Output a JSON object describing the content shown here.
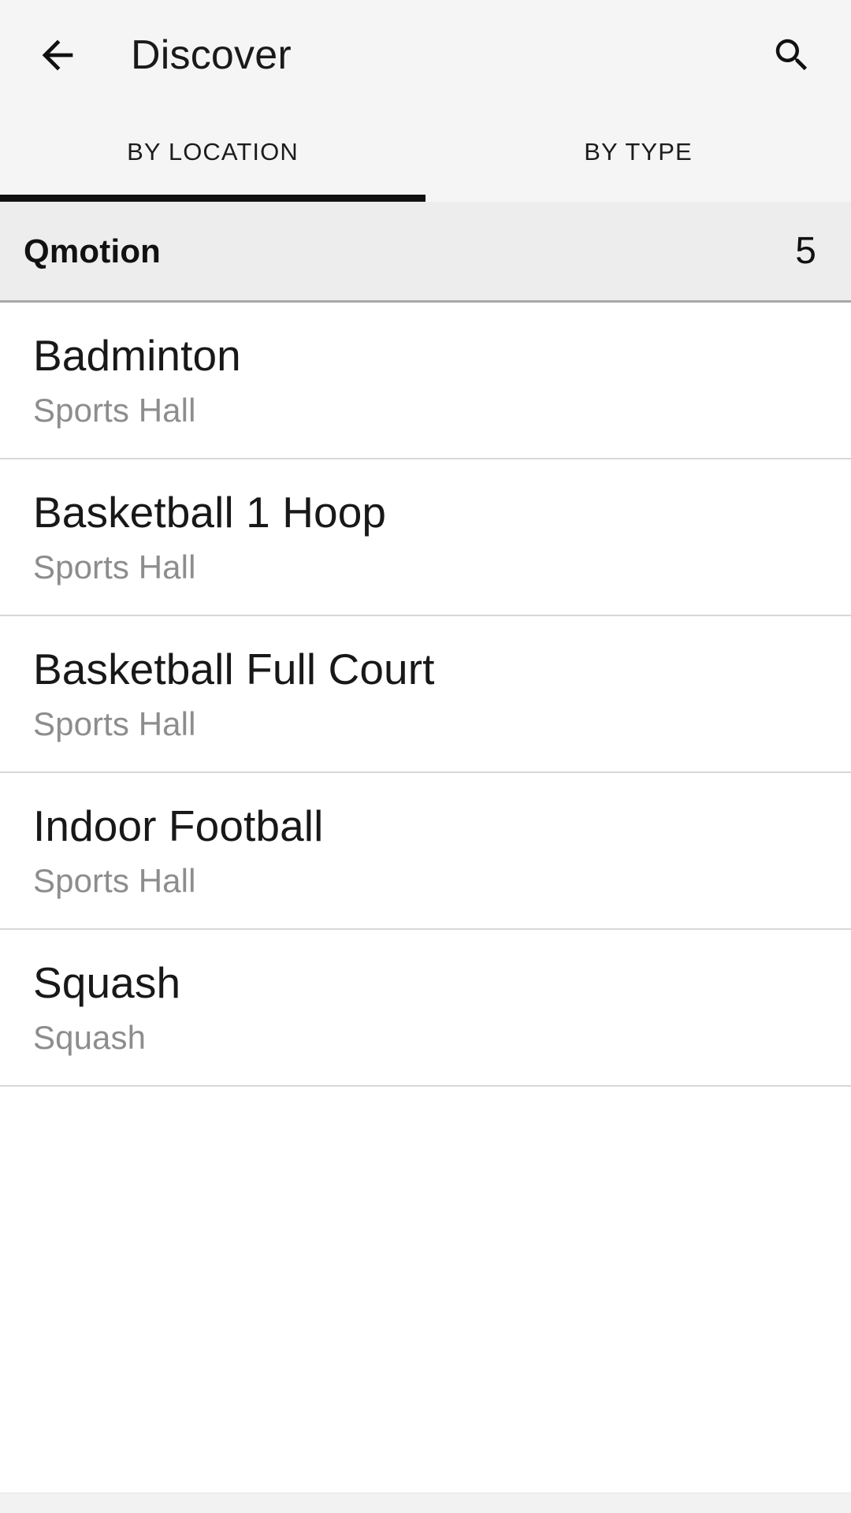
{
  "appbar": {
    "back_icon": "arrow-left-icon",
    "title": "Discover",
    "search_icon": "search-icon"
  },
  "tabs": [
    {
      "label": "BY LOCATION",
      "active": true
    },
    {
      "label": "BY TYPE",
      "active": false
    }
  ],
  "section": {
    "title": "Qmotion",
    "count": "5"
  },
  "list": {
    "items": [
      {
        "title": "Badminton",
        "subtitle": "Sports Hall"
      },
      {
        "title": "Basketball 1 Hoop",
        "subtitle": "Sports Hall"
      },
      {
        "title": "Basketball Full Court",
        "subtitle": "Sports Hall"
      },
      {
        "title": "Indoor Football",
        "subtitle": "Sports Hall"
      },
      {
        "title": "Squash",
        "subtitle": "Squash"
      }
    ]
  },
  "colors": {
    "appbar_bg": "#f5f5f5",
    "section_bg": "#ededed",
    "content_bg": "#ffffff",
    "accent_underline": "#111111",
    "title_text": "#181818",
    "subtitle_text": "#8d8d8d",
    "divider": "#d8d8d8"
  }
}
